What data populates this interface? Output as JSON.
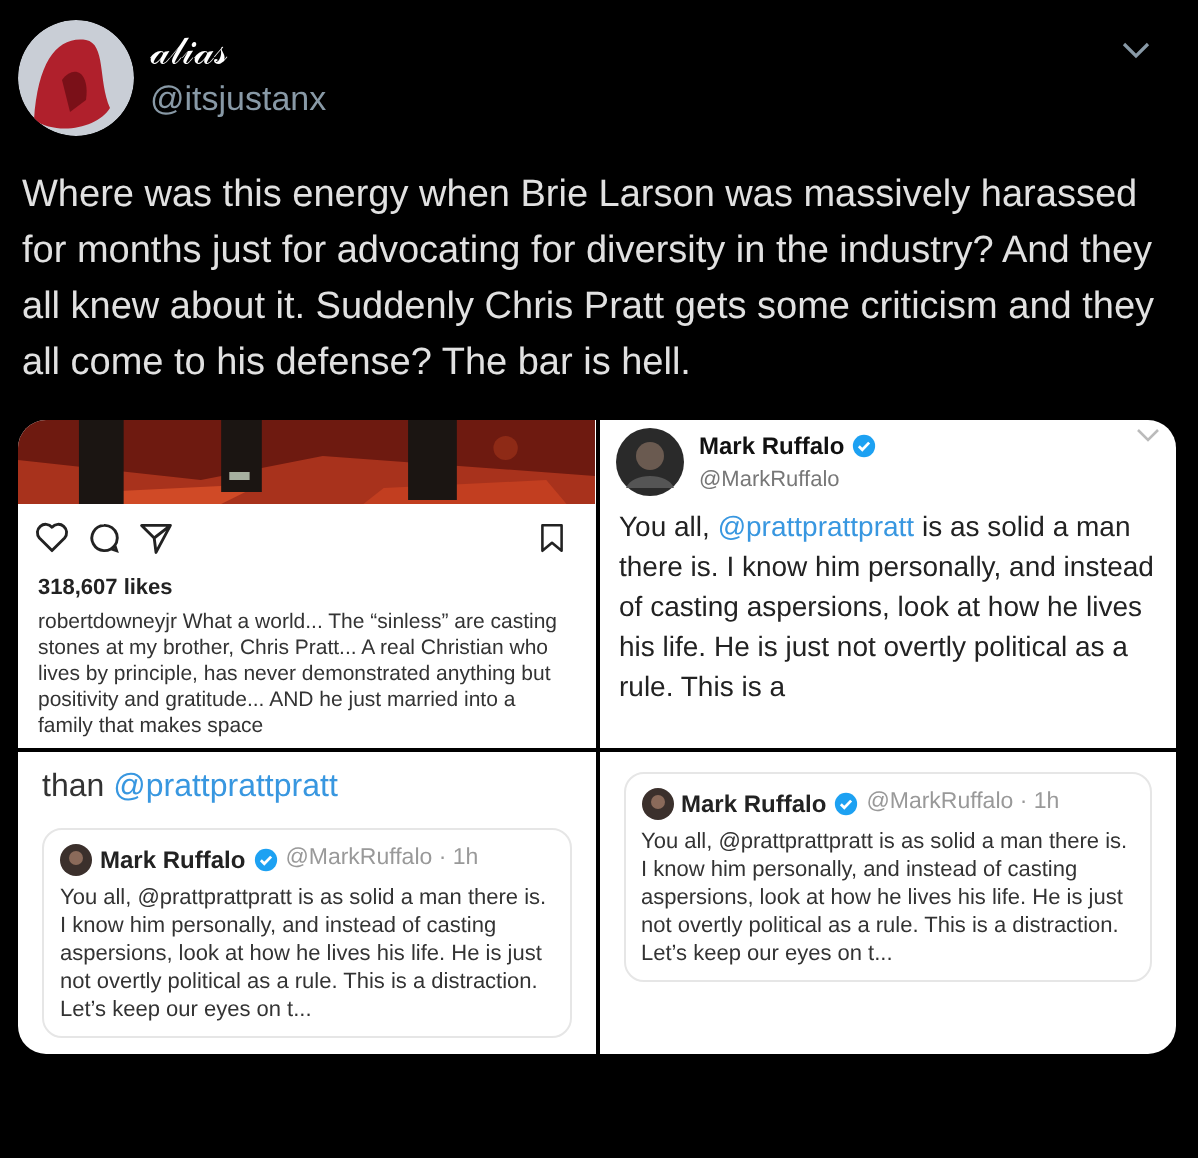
{
  "tweet": {
    "display_name": "𝒶𝓁𝒾𝒶𝓈",
    "handle": "@itsjustanx",
    "text": "Where was this energy when Brie Larson was massively harassed for months just for advocating for diversity in the industry? And they all knew about it. Suddenly Chris Pratt gets some criticism and they all come to his defense? The bar is hell."
  },
  "media": [
    {
      "kind": "instagram",
      "likes": "318,607 likes",
      "caption": "robertdowneyjr What a world... The “sinless” are casting stones at my brother, Chris Pratt... A real Christian who lives by principle, has never demonstrated anything but positivity and gratitude... AND he just married into a family that makes space"
    },
    {
      "kind": "tweet",
      "name": "Mark Ruffalo",
      "handle": "@MarkRuffalo",
      "parts": [
        {
          "kind": "text",
          "text": "You all, "
        },
        {
          "kind": "mention",
          "text": "@prattprattpratt"
        },
        {
          "kind": "text",
          "text": " is as solid a man there is. I know him personally, and instead of casting aspersions, look at how he lives his life. He is just not overtly political as a rule. This is a"
        }
      ]
    },
    {
      "kind": "reply",
      "parts": [
        {
          "kind": "text",
          "text": "than "
        },
        {
          "kind": "mention",
          "text": "@prattprattpratt"
        }
      ],
      "quote": {
        "name": "Mark Ruffalo",
        "meta": "@MarkRuffalo · 1h",
        "text": "You all, @prattprattpratt is as solid a man there is. I know him personally, and instead of casting aspersions, look at how he lives his life. He is just not overtly political as a rule. This is a distraction. Let’s keep our eyes on t..."
      }
    },
    {
      "kind": "quote",
      "quote": {
        "name": "Mark Ruffalo",
        "meta": "@MarkRuffalo · 1h",
        "text": "You all, @prattprattpratt is as solid a man there is. I know him personally, and instead of casting aspersions, look at how he lives his life. He is just not overtly political as a rule. This is a distraction. Let’s keep our eyes on t..."
      }
    }
  ]
}
